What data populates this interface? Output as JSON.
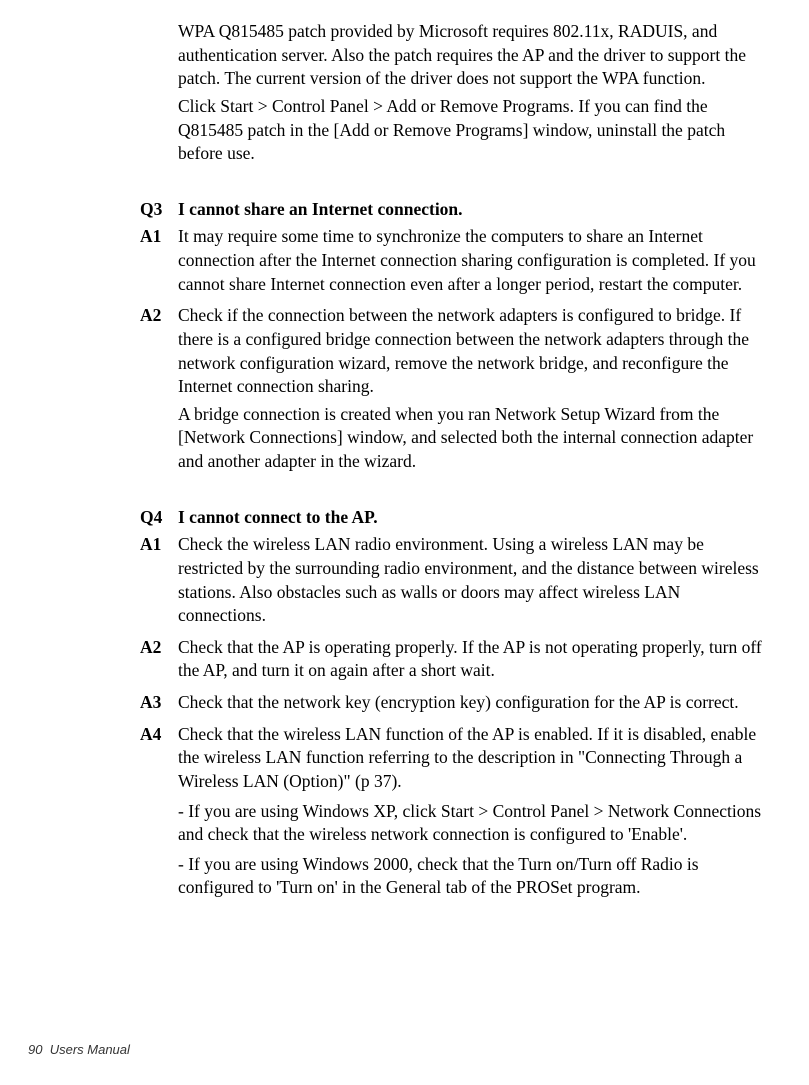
{
  "intro": {
    "p1": "WPA Q815485 patch provided by Microsoft requires 802.11x, RADUIS, and authentication server. Also the patch requires the AP and the driver to support the patch. The current version of the driver does not support the WPA function.",
    "p2": "Click Start > Control Panel > Add or Remove Programs. If you can find the Q815485 patch in the [Add or Remove Programs] window, uninstall the patch before use."
  },
  "q3": {
    "label": "Q3",
    "title": "I cannot share an Internet connection.",
    "a1": {
      "label": "A1",
      "p1": "It may require some time to synchronize the computers to share an Internet connection after the Internet connection sharing configuration is completed. If you cannot share Internet connection even after a longer period, restart the computer."
    },
    "a2": {
      "label": "A2",
      "p1": "Check if the connection between the network adapters is configured to bridge. If there is a configured bridge connection between the network adapters through the network configuration wizard, remove the network bridge, and reconfigure the Internet connection sharing.",
      "p2": "A bridge connection is created when you ran Network Setup Wizard from the [Network Connections] window, and selected both the internal connection adapter and another adapter in the wizard."
    }
  },
  "q4": {
    "label": "Q4",
    "title": "I cannot connect to the AP.",
    "a1": {
      "label": "A1",
      "p1": "Check the wireless LAN radio environment. Using a wireless LAN may be restricted by the surrounding radio environment, and the distance between wireless stations. Also obstacles such as walls or doors may affect wireless LAN connections."
    },
    "a2": {
      "label": "A2",
      "p1": "Check that the AP is operating properly. If the AP is not operating properly, turn off the AP, and turn it on again after a short wait."
    },
    "a3": {
      "label": "A3",
      "p1": "Check that the network key (encryption key) configuration for the AP is correct."
    },
    "a4": {
      "label": "A4",
      "p1": "Check that the wireless LAN function of the AP is enabled. If it is disabled, enable the wireless LAN function referring to the description in \"Connecting Through a Wireless LAN (Option)\" (p 37).",
      "p2": "- If you are using Windows XP, click Start > Control Panel > Network Connections and check that the wireless network connection is configured to 'Enable'.",
      "p3": "- If you are using Windows 2000, check that the Turn on/Turn off Radio is configured to 'Turn on' in the General tab of the PROSet program."
    }
  },
  "footer": {
    "page": "90",
    "title": "Users Manual"
  }
}
